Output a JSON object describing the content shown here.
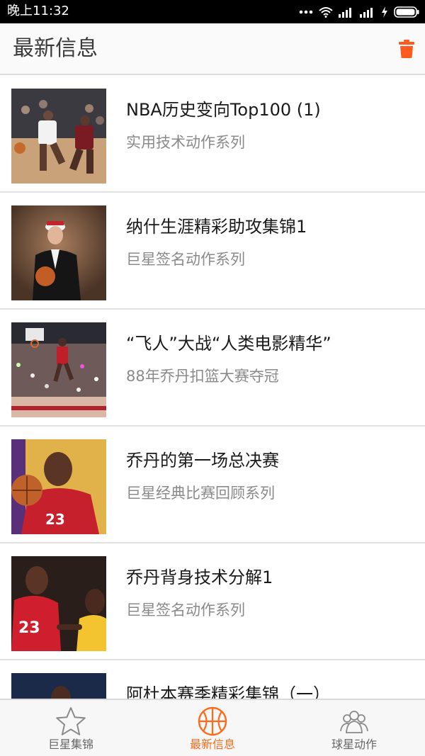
{
  "status_bar": {
    "time": "晚上11:32"
  },
  "header": {
    "title": "最新信息",
    "delete_icon": "trash-icon",
    "accent_color": "#ff5a1f"
  },
  "news": [
    {
      "title": "NBA历史变向Top100 (1)",
      "subtitle": "实用技术动作系列"
    },
    {
      "title": "纳什生涯精彩助攻集锦1",
      "subtitle": "巨星签名动作系列"
    },
    {
      "title": "“飞人”大战“人类电影精华”",
      "subtitle": "88年乔丹扣篮大赛夺冠"
    },
    {
      "title": "乔丹的第一场总决赛",
      "subtitle": "巨星经典比赛回顾系列"
    },
    {
      "title": "乔丹背身技术分解1",
      "subtitle": "巨星签名动作系列"
    },
    {
      "title": "阿杜本赛季精彩集锦（一）",
      "subtitle": ""
    }
  ],
  "bottom_nav": {
    "tabs": [
      {
        "label": "巨星集锦",
        "icon": "star-icon",
        "active": false
      },
      {
        "label": "最新信息",
        "icon": "basketball-icon",
        "active": true
      },
      {
        "label": "球星动作",
        "icon": "players-icon",
        "active": false
      }
    ],
    "active_color": "#ff6a1a"
  }
}
